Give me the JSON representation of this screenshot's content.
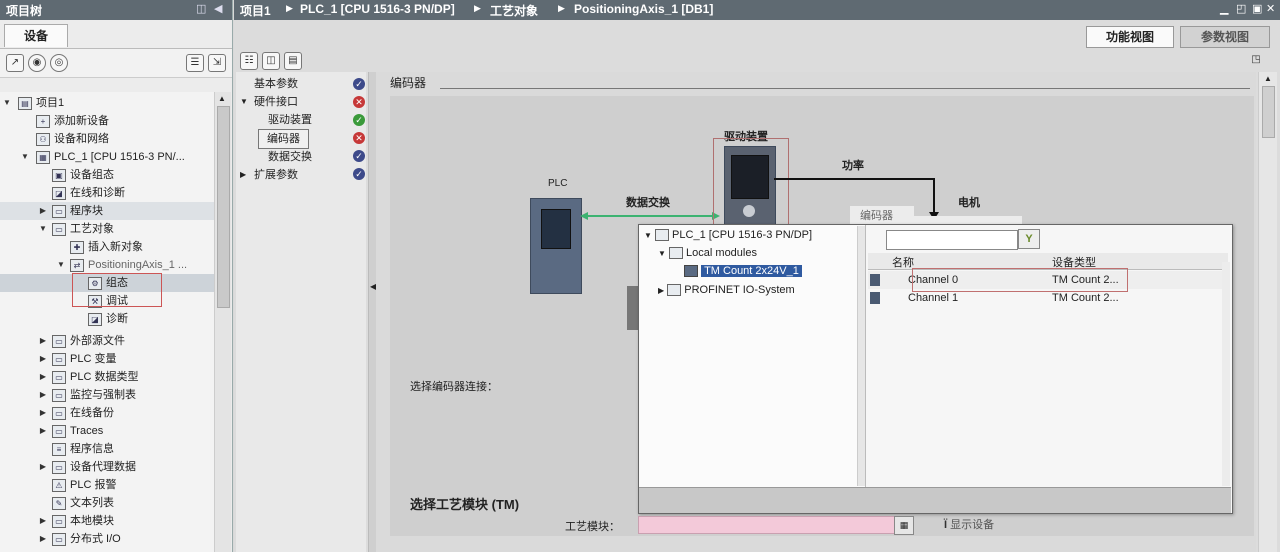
{
  "project_tree": {
    "title": "项目树",
    "tab_devices": "设备",
    "items": [
      {
        "label": "项目1"
      },
      {
        "label": "添加新设备"
      },
      {
        "label": "设备和网络"
      },
      {
        "label": "PLC_1 [CPU 1516-3 PN/..."
      },
      {
        "label": "设备组态"
      },
      {
        "label": "在线和诊断"
      },
      {
        "label": "程序块"
      },
      {
        "label": "工艺对象"
      },
      {
        "label": "插入新对象"
      },
      {
        "label": "PositioningAxis_1 ..."
      },
      {
        "label": "组态"
      },
      {
        "label": "调试"
      },
      {
        "label": "诊断"
      },
      {
        "label": "外部源文件"
      },
      {
        "label": "PLC 变量"
      },
      {
        "label": "PLC 数据类型"
      },
      {
        "label": "监控与强制表"
      },
      {
        "label": "在线备份"
      },
      {
        "label": "Traces"
      },
      {
        "label": "程序信息"
      },
      {
        "label": "设备代理数据"
      },
      {
        "label": "PLC 报警"
      },
      {
        "label": "文本列表"
      },
      {
        "label": "本地模块"
      },
      {
        "label": "分布式 I/O"
      }
    ]
  },
  "breadcrumb": {
    "items": [
      "项目1",
      "PLC_1 [CPU 1516-3 PN/DP]",
      "工艺对象",
      "PositioningAxis_1 [DB1]"
    ]
  },
  "view_tabs": {
    "function_view": "功能视图",
    "parameter_view": "参数视图"
  },
  "nav": {
    "items": [
      {
        "label": "基本参数",
        "status": "ok"
      },
      {
        "label": "硬件接口",
        "status": "error"
      },
      {
        "label": "驱动装置",
        "status": "green"
      },
      {
        "label": "编码器",
        "status": "error"
      },
      {
        "label": "数据交换",
        "status": "ok"
      },
      {
        "label": "扩展参数",
        "status": "ok"
      }
    ]
  },
  "section": {
    "title": "编码器"
  },
  "diagram": {
    "plc_label": "PLC",
    "data_exchange": "数据交换",
    "drive_label": "驱动装置",
    "power_label": "功率",
    "encoder_label": "编码器",
    "motor_label": "电机",
    "select_encoder_connection": "选择编码器连接："
  },
  "popup": {
    "tree": [
      {
        "label": "PLC_1 [CPU 1516-3 PN/DP]"
      },
      {
        "label": "Local modules"
      },
      {
        "label": "TM Count 2x24V_1"
      },
      {
        "label": "PROFINET IO-System"
      }
    ],
    "filter_placeholder": "",
    "grid_headers": {
      "name": "名称",
      "device_type": "设备类型"
    },
    "grid_rows": [
      {
        "name": "Channel 0",
        "device_type": "TM Count 2..."
      },
      {
        "name": "Channel 1",
        "device_type": "TM Count 2..."
      }
    ]
  },
  "tm_module": {
    "title": "选择工艺模块 (TM)",
    "field_label": "工艺模块：",
    "field_value": "",
    "show_device": "显示设备"
  },
  "colors": {
    "title_bar": "#5f6a72",
    "field_invalid": "#f3c9d9",
    "status_error": "#c63838",
    "status_ok": "#3d4a8a",
    "status_green": "#3a9a3a",
    "connection_green": "#3cb371"
  }
}
